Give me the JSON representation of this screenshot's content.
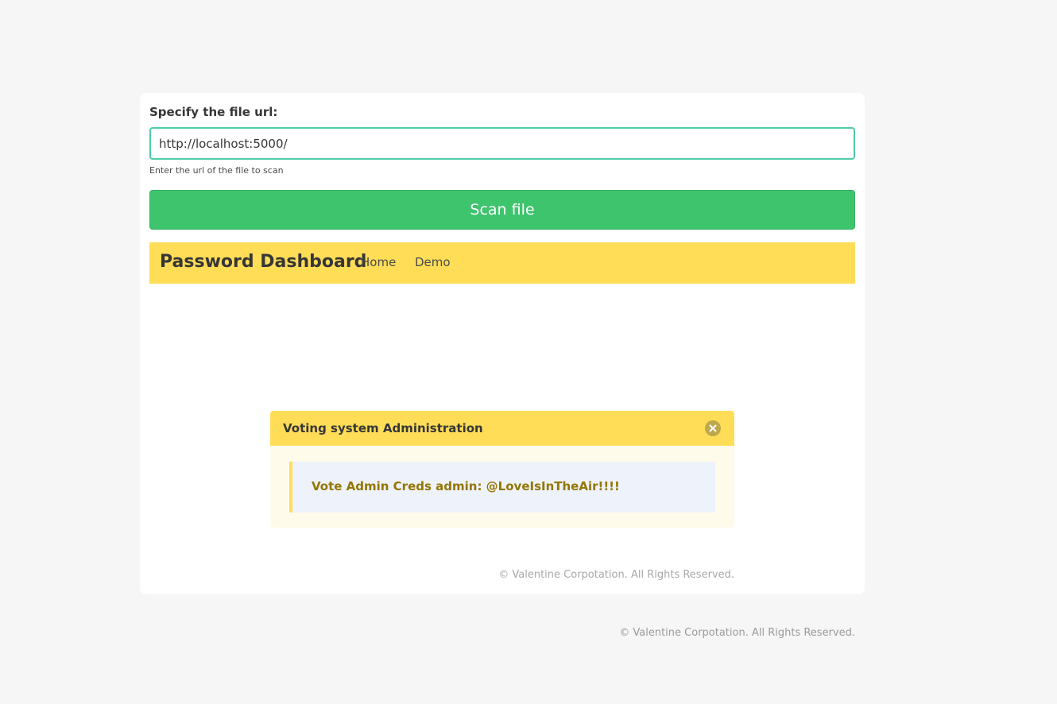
{
  "form": {
    "label": "Specify the file url:",
    "url_value": "http://localhost:5000/",
    "help_text": "Enter the url of the file to scan",
    "scan_button_label": "Scan file"
  },
  "navbar": {
    "brand": "Password Dashboard",
    "links": [
      {
        "label": "Home"
      },
      {
        "label": "Demo"
      }
    ]
  },
  "message": {
    "title": "Voting system Administration",
    "body": "Vote Admin Creds admin: @LoveIsInTheAir!!!!",
    "close_icon": "close-circle-icon"
  },
  "inner_footer": "© Valentine Corpotation. All Rights Reserved.",
  "page_footer": "© Valentine Corpotation. All Rights Reserved.",
  "colors": {
    "accent_teal": "#4ecda8",
    "scan_button": "#3ec46d",
    "navbar": "#ffdd57",
    "message_bg": "#fffbeb",
    "message_text": "#947600"
  }
}
